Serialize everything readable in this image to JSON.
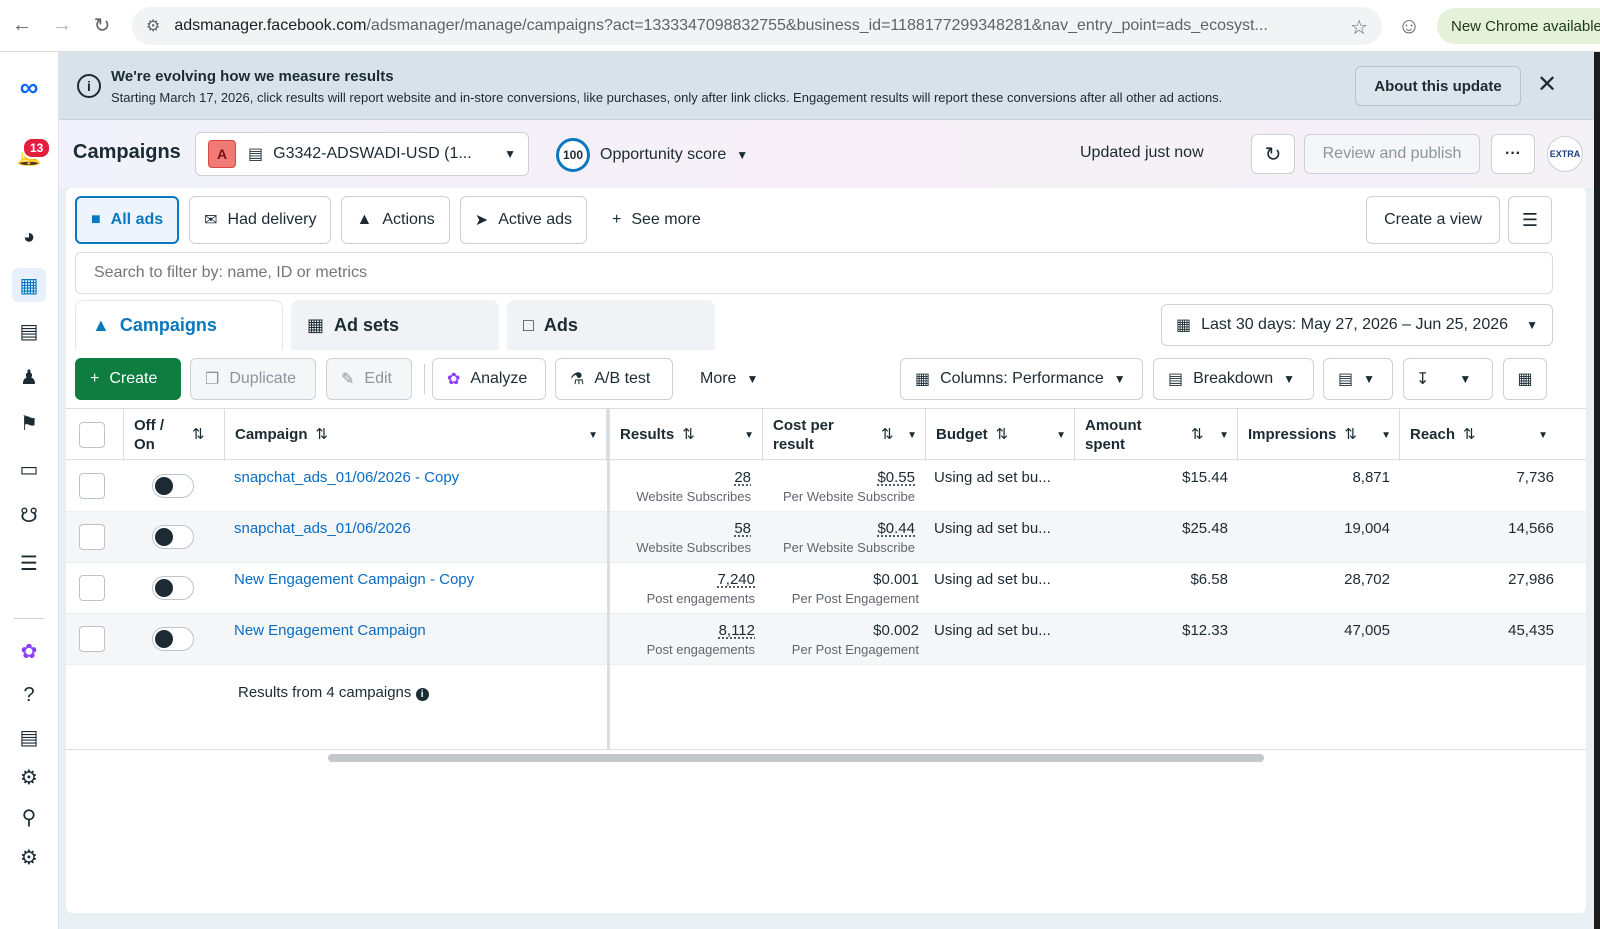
{
  "browser": {
    "url_host": "adsmanager.facebook.com",
    "url_path": "/adsmanager/manage/campaigns?act=1333347098832755&business_id=1188177299348281&nav_entry_point=ads_ecosyst...",
    "new_chrome": "New Chrome available"
  },
  "rail": {
    "notif_count": "13"
  },
  "banner": {
    "title": "We're evolving how we measure results",
    "text": "Starting March 17, 2026, click results will report website and in-store conversions, like purchases, only after link clicks. Engagement results will report these conversions after all other ad actions.",
    "about_label": "About this update"
  },
  "header": {
    "title": "Campaigns",
    "account_initial": "A",
    "account_name": "G3342-ADSWADI-USD (1...",
    "opportunity_score": "100",
    "opportunity_label": "Opportunity score",
    "updated": "Updated just now",
    "review_publish": "Review and publish",
    "more": "···",
    "avatar_text": "EXTRA"
  },
  "views": {
    "all_ads": "All ads",
    "had_delivery": "Had delivery",
    "actions": "Actions",
    "active_ads": "Active ads",
    "see_more": "See more",
    "create_view": "Create a view"
  },
  "search": {
    "placeholder": "Search to filter by: name, ID or metrics"
  },
  "tabs": {
    "campaigns": "Campaigns",
    "ad_sets": "Ad sets",
    "ads": "Ads"
  },
  "date_range": "Last 30 days: May 27, 2026 – Jun 25, 2026",
  "toolbar": {
    "create": "Create",
    "duplicate": "Duplicate",
    "edit": "Edit",
    "analyze": "Analyze",
    "ab_test": "A/B test",
    "more": "More",
    "columns": "Columns: Performance",
    "breakdown": "Breakdown"
  },
  "table": {
    "headers": {
      "off_on": "Off / On",
      "campaign": "Campaign",
      "results": "Results",
      "cost_per_result": "Cost per result",
      "budget": "Budget",
      "amount_spent": "Amount spent",
      "impressions": "Impressions",
      "reach": "Reach"
    },
    "rows": [
      {
        "name": "snapchat_ads_01/06/2026 - Copy",
        "results": "28",
        "results_sub": "Website Subscribes",
        "cpr": "$0.55",
        "cpr_sub": "Per Website Subscribe",
        "budget": "Using ad set bu...",
        "spent": "$15.44",
        "impressions": "8,871",
        "reach": "7,736"
      },
      {
        "name": "snapchat_ads_01/06/2026",
        "results": "58",
        "results_sub": "Website Subscribes",
        "cpr": "$0.44",
        "cpr_sub": "Per Website Subscribe",
        "budget": "Using ad set bu...",
        "spent": "$25.48",
        "impressions": "19,004",
        "reach": "14,566"
      },
      {
        "name": "New Engagement Campaign - Copy",
        "results": "7,240",
        "results_sub": "Post engagements",
        "cpr": "$0.001",
        "cpr_sub": "Per Post Engagement",
        "budget": "Using ad set bu...",
        "spent": "$6.58",
        "impressions": "28,702",
        "reach": "27,986"
      },
      {
        "name": "New Engagement Campaign",
        "results": "8,112",
        "results_sub": "Post engagements",
        "cpr": "$0.002",
        "cpr_sub": "Per Post Engagement",
        "budget": "Using ad set bu...",
        "spent": "$12.33",
        "impressions": "47,005",
        "reach": "45,435"
      }
    ],
    "summary": "Results from 4 campaigns"
  }
}
